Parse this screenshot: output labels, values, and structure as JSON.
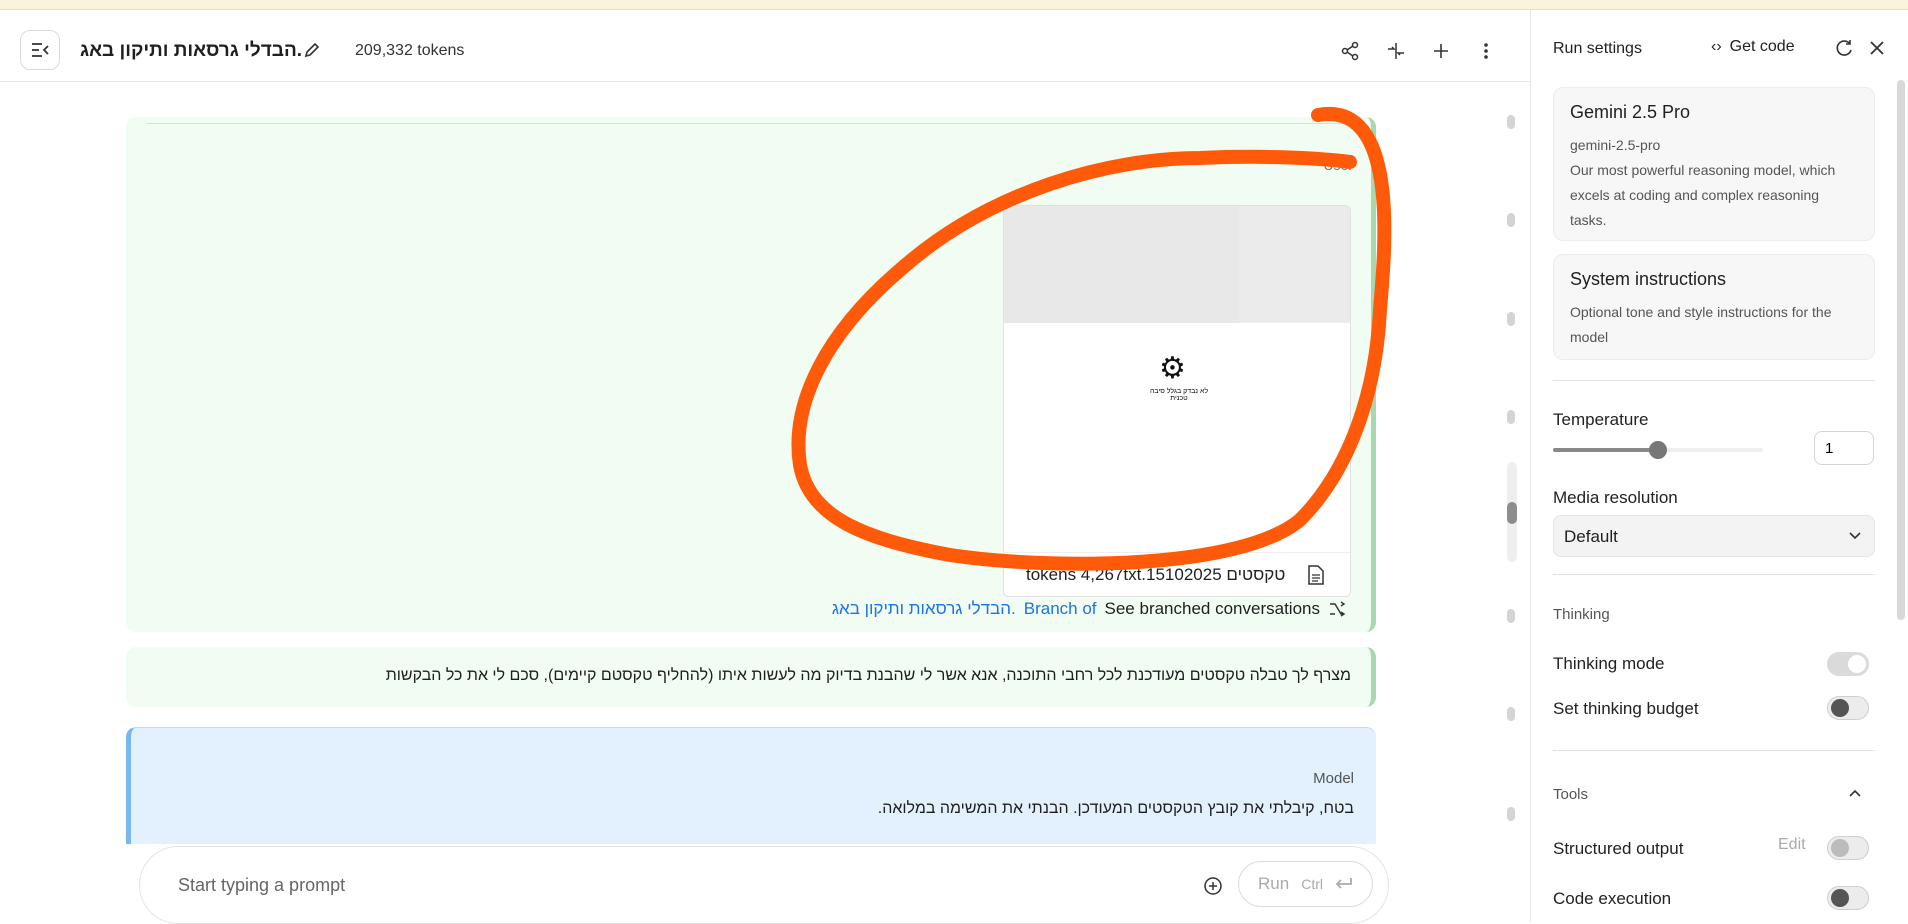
{
  "header": {
    "title": "הבדלי גרסאות ותיקון באג.",
    "tokens": "209,332 tokens"
  },
  "user_message": {
    "role": "User",
    "attachment": {
      "filename": "tokens 4,267txt.15102025 טקסטים",
      "thumbnail_caption": "לא נבדק בגלל סיבה טכנית"
    },
    "branch": {
      "prefix": "See branched conversations",
      "link_prefix": "Branch of",
      "link_title": "הבדלי גרסאות ותיקון באג."
    }
  },
  "user_message_2": {
    "text": "מצרף לך טבלה טקסטים מעודכנת לכל רחבי התוכנה, אנא אשר לי שהבנת בדיוק מה לעשות איתו (להחליף טקסטם קיימים), סכם לי את כל הבקשות"
  },
  "model_message": {
    "role": "Model",
    "text": "בטח, קיבלתי את קובץ הטקסטים המעודכן. הבנתי את המשימה במלואה."
  },
  "prompt": {
    "placeholder": "Start typing a prompt",
    "run_label": "Run",
    "run_shortcut": "Ctrl"
  },
  "panel": {
    "title": "Run settings",
    "get_code": "Get code",
    "model": {
      "name": "Gemini 2.5 Pro",
      "id": "gemini-2.5-pro",
      "description": "Our most powerful reasoning model, which excels at coding and complex reasoning tasks."
    },
    "system_instructions": {
      "title": "System instructions",
      "description": "Optional tone and style instructions for the model"
    },
    "temperature": {
      "label": "Temperature",
      "value": "1"
    },
    "media_resolution": {
      "label": "Media resolution",
      "value": "Default"
    },
    "thinking": {
      "section": "Thinking",
      "mode_label": "Thinking mode",
      "budget_label": "Set thinking budget"
    },
    "tools": {
      "section": "Tools",
      "structured_output": "Structured output",
      "edit": "Edit",
      "code_execution": "Code execution"
    }
  },
  "colors": {
    "user_bg": "#f1fcf2",
    "model_bg": "#e3f0fd",
    "link": "#1a73e8",
    "annotation": "#ff5a0a"
  }
}
